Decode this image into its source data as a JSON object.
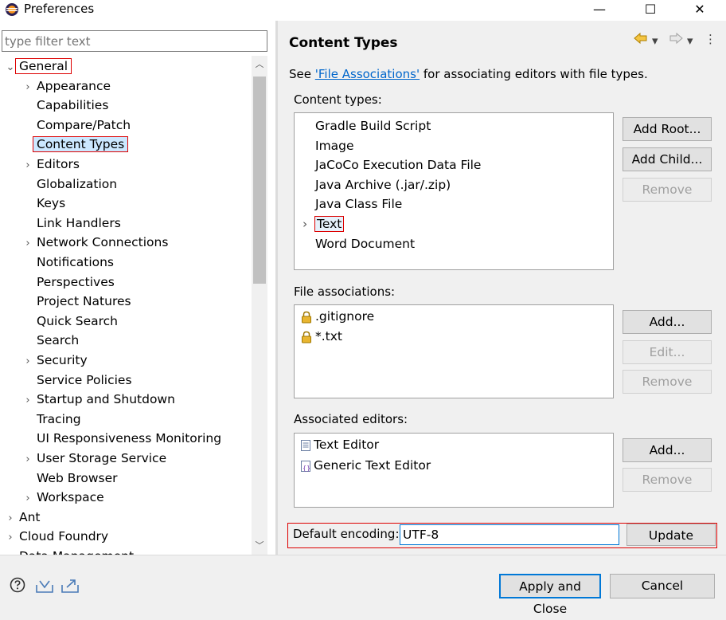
{
  "window": {
    "title": "Preferences",
    "minimize": "—",
    "maximize": "☐",
    "close": "✕"
  },
  "filter": {
    "placeholder": "type filter text",
    "value": ""
  },
  "tree": {
    "items": [
      {
        "label": "General",
        "chevron": "v",
        "indent": 0,
        "highlight": true
      },
      {
        "label": "Appearance",
        "chevron": ">",
        "indent": 1
      },
      {
        "label": "Capabilities",
        "chevron": "",
        "indent": 1
      },
      {
        "label": "Compare/Patch",
        "chevron": "",
        "indent": 1
      },
      {
        "label": "Content Types",
        "chevron": "",
        "indent": 1,
        "selected": true,
        "highlight": true
      },
      {
        "label": "Editors",
        "chevron": ">",
        "indent": 1
      },
      {
        "label": "Globalization",
        "chevron": "",
        "indent": 1
      },
      {
        "label": "Keys",
        "chevron": "",
        "indent": 1
      },
      {
        "label": "Link Handlers",
        "chevron": "",
        "indent": 1
      },
      {
        "label": "Network Connections",
        "chevron": ">",
        "indent": 1
      },
      {
        "label": "Notifications",
        "chevron": "",
        "indent": 1
      },
      {
        "label": "Perspectives",
        "chevron": "",
        "indent": 1
      },
      {
        "label": "Project Natures",
        "chevron": "",
        "indent": 1
      },
      {
        "label": "Quick Search",
        "chevron": "",
        "indent": 1
      },
      {
        "label": "Search",
        "chevron": "",
        "indent": 1
      },
      {
        "label": "Security",
        "chevron": ">",
        "indent": 1
      },
      {
        "label": "Service Policies",
        "chevron": "",
        "indent": 1
      },
      {
        "label": "Startup and Shutdown",
        "chevron": ">",
        "indent": 1
      },
      {
        "label": "Tracing",
        "chevron": "",
        "indent": 1
      },
      {
        "label": "UI Responsiveness Monitoring",
        "chevron": "",
        "indent": 1
      },
      {
        "label": "User Storage Service",
        "chevron": ">",
        "indent": 1
      },
      {
        "label": "Web Browser",
        "chevron": "",
        "indent": 1
      },
      {
        "label": "Workspace",
        "chevron": ">",
        "indent": 1
      },
      {
        "label": "Ant",
        "chevron": ">",
        "indent": 0
      },
      {
        "label": "Cloud Foundry",
        "chevron": ">",
        "indent": 0
      },
      {
        "label": "Data Management",
        "chevron": ">",
        "indent": 0
      }
    ]
  },
  "page": {
    "title": "Content Types",
    "see_prefix": "See ",
    "see_link": "'File Associations'",
    "see_suffix": " for associating editors with file types.",
    "content_types_label": "Content types:",
    "content_types": [
      {
        "label": "Gradle Build Script",
        "chevron": ""
      },
      {
        "label": "Image",
        "chevron": ""
      },
      {
        "label": "JaCoCo Execution Data File",
        "chevron": ""
      },
      {
        "label": "Java Archive (.jar/.zip)",
        "chevron": ""
      },
      {
        "label": "Java Class File",
        "chevron": ""
      },
      {
        "label": "Text",
        "chevron": ">",
        "highlight": true
      },
      {
        "label": "Word Document",
        "chevron": ""
      }
    ],
    "add_root": "Add Root...",
    "add_child": "Add Child...",
    "remove_types": "Remove",
    "file_assoc_label": "File associations:",
    "file_assocs": [
      ".gitignore",
      "*.txt"
    ],
    "fa_add": "Add...",
    "fa_edit": "Edit...",
    "fa_remove": "Remove",
    "assoc_editors_label": "Associated editors:",
    "assoc_editors": [
      "Text Editor",
      "Generic Text Editor"
    ],
    "ae_add": "Add...",
    "ae_remove": "Remove",
    "encoding_label": "Default encoding:",
    "encoding_value": "UTF-8",
    "update": "Update"
  },
  "footer": {
    "apply_close": "Apply and Close",
    "cancel": "Cancel"
  },
  "colors": {
    "accent": "#0078d7",
    "highlight_border": "#dd0000",
    "selection": "#cce8ff",
    "link": "#0066cc"
  }
}
